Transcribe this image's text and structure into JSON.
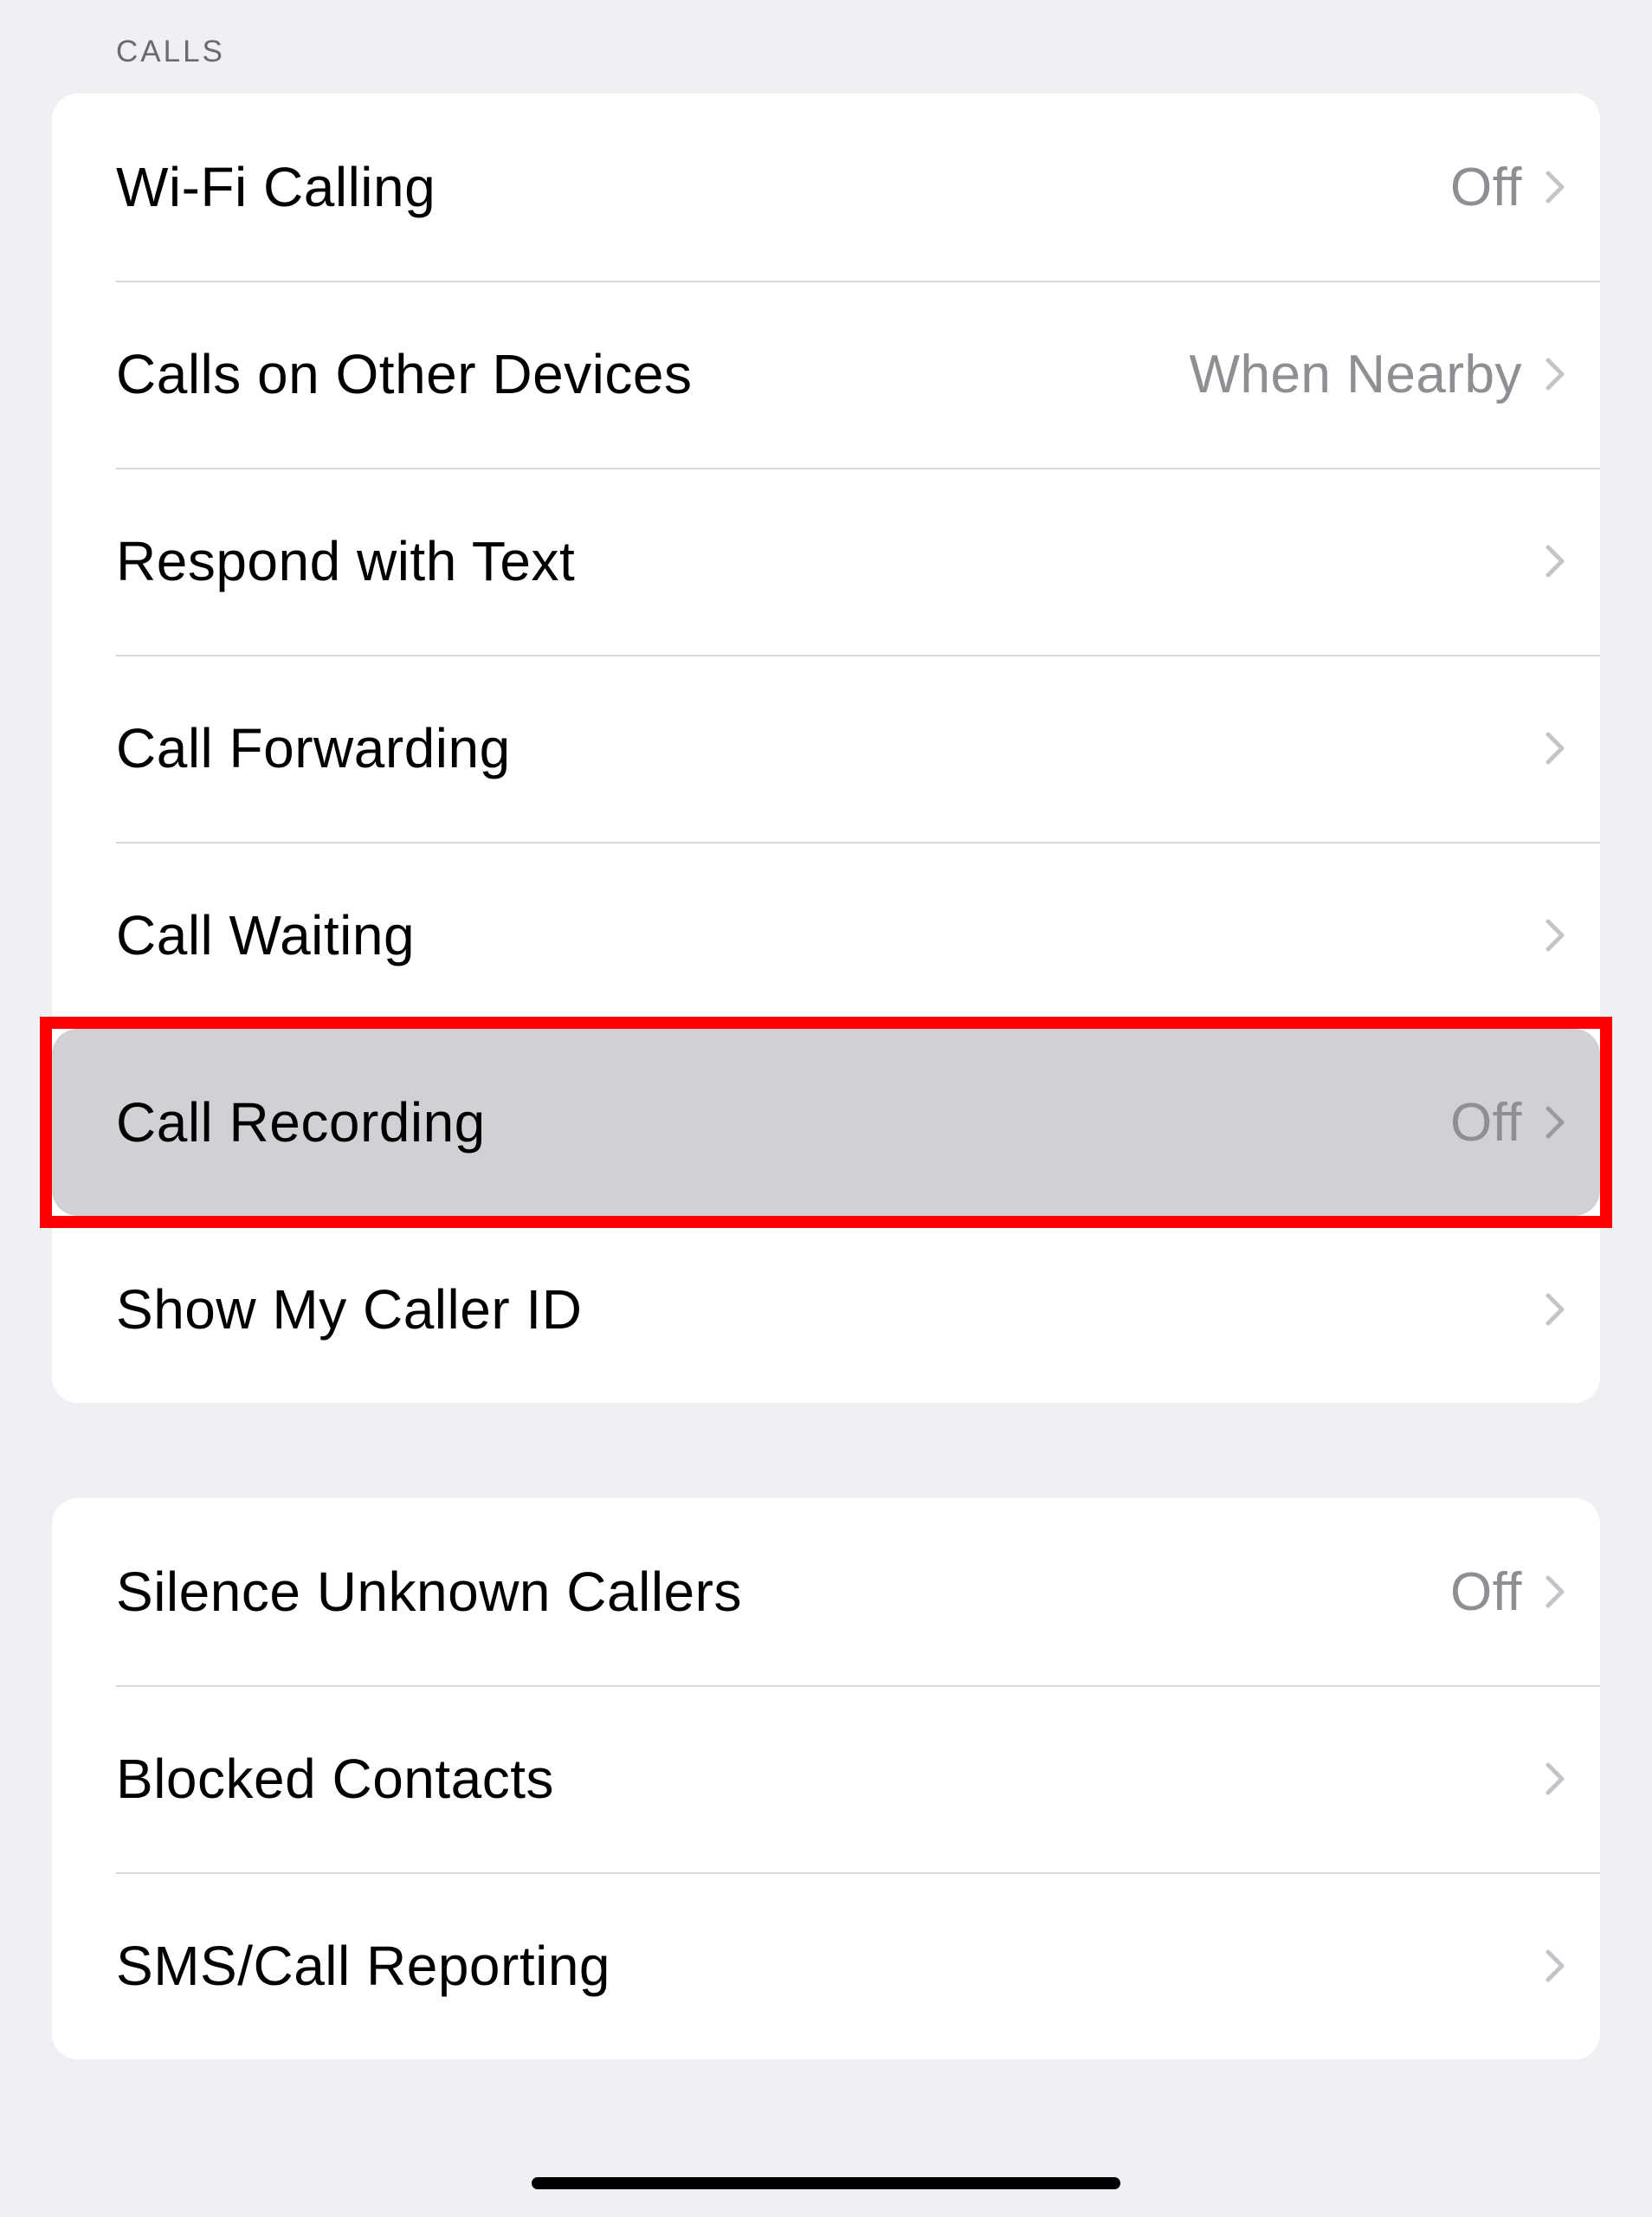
{
  "sections": {
    "calls_header": "CALLS"
  },
  "group1": [
    {
      "label": "Wi-Fi Calling",
      "value": "Off",
      "name": "wifi-calling"
    },
    {
      "label": "Calls on Other Devices",
      "value": "When Nearby",
      "name": "calls-other-devices"
    },
    {
      "label": "Respond with Text",
      "value": "",
      "name": "respond-with-text"
    },
    {
      "label": "Call Forwarding",
      "value": "",
      "name": "call-forwarding"
    },
    {
      "label": "Call Waiting",
      "value": "",
      "name": "call-waiting"
    },
    {
      "label": "Call Recording",
      "value": "Off",
      "name": "call-recording"
    },
    {
      "label": "Show My Caller ID",
      "value": "",
      "name": "show-my-caller-id"
    }
  ],
  "group2": [
    {
      "label": "Silence Unknown Callers",
      "value": "Off",
      "name": "silence-unknown-callers"
    },
    {
      "label": "Blocked Contacts",
      "value": "",
      "name": "blocked-contacts"
    },
    {
      "label": "SMS/Call Reporting",
      "value": "",
      "name": "sms-call-reporting"
    }
  ],
  "highlight_row_name": "call-recording",
  "chevron_color": "#c4c4c9"
}
